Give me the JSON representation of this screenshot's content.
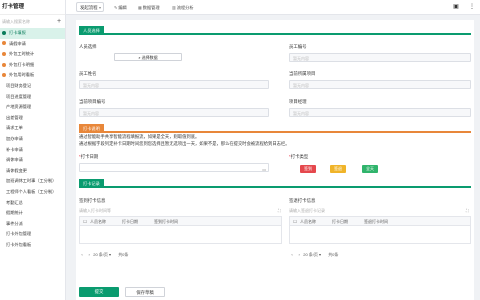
{
  "colors": {
    "primary": "#0a9b6f",
    "orange": "#e8873a",
    "red": "#e5484d",
    "yellow": "#f0b429",
    "green": "#30b46c"
  },
  "sidebar": {
    "title": "打卡管理",
    "search_placeholder": "请输入搜索名称",
    "add_icon": "plus-icon",
    "items": [
      {
        "label": "打卡填报",
        "type": "sub",
        "active": true
      },
      {
        "label": "请假申请",
        "type": "sub"
      },
      {
        "label": "外包工时统计",
        "type": "sub"
      },
      {
        "label": "外包打卡明细",
        "type": "sub"
      },
      {
        "label": "外包用时看板",
        "type": "sub"
      },
      {
        "label": "项目财务登记",
        "type": "plain"
      },
      {
        "label": "项目进度管理",
        "type": "plain"
      },
      {
        "label": "产地资源管理",
        "type": "plain"
      },
      {
        "label": "出差管理",
        "type": "plain"
      },
      {
        "label": "请求工单",
        "type": "plain"
      },
      {
        "label": "加办申请",
        "type": "plain"
      },
      {
        "label": "补卡申请",
        "type": "plain"
      },
      {
        "label": "调休申请",
        "type": "plain"
      },
      {
        "label": "请休假变更",
        "type": "plain"
      },
      {
        "label": "加班调休工时事（工分制）",
        "type": "plain"
      },
      {
        "label": "工程师个人看板（工分制）",
        "type": "plain"
      },
      {
        "label": "考勤汇总",
        "type": "plain"
      },
      {
        "label": "假期统计",
        "type": "plain"
      },
      {
        "label": "事件分派",
        "type": "plain"
      },
      {
        "label": "打卡外包管理",
        "type": "plain"
      },
      {
        "label": "打卡外包看板",
        "type": "plain"
      }
    ]
  },
  "topbar": {
    "dropdown": "发起流程",
    "buttons": [
      "编辑",
      "数据管理",
      "流程分析"
    ],
    "right_icons": [
      "layout-icon",
      "more-icon"
    ]
  },
  "form": {
    "section1": "人员选择",
    "person_label": "人员选择",
    "person_button": "选择数据",
    "employee_no_label": "员工编号",
    "employee_no_placeholder": "暂无内容",
    "employee_name_label": "员工姓名",
    "employee_name_placeholder": "暂无内容",
    "project_manager_label": "当前所属项目",
    "project_manager_placeholder": "暂无内容",
    "project_no_label": "当前项目编号",
    "project_no_placeholder": "暂无内容",
    "project_manager2_label": "项目经理",
    "project_manager2_placeholder": "暂无内容",
    "section2": "打卡说明",
    "notice_line1": "通过智能助手共享智能流程填报流，如果是全天，则取值到底。",
    "notice_line2": "通过根据字段列定补卡日期时间您到您选择且暂无选项出一天，如果不是，那么在提交时会被流程给到日志栏。",
    "date_label": "打卡日期",
    "type_label": "打卡类型",
    "chips": [
      {
        "label": "签到",
        "color": "#e5484d"
      },
      {
        "label": "签退",
        "color": "#f0b429"
      },
      {
        "label": "全天",
        "color": "#30b46c"
      }
    ],
    "section3": "打卡记录",
    "left_table": {
      "title": "签到打卡信息",
      "hint": "请输入打卡时间等",
      "columns": [
        "人员名称",
        "打卡日期",
        "签到打卡时间"
      ],
      "page_size": "20 条/页",
      "total": "共0条"
    },
    "right_table": {
      "title": "签退打卡信息",
      "hint": "请输入签退打卡记录",
      "columns": [
        "人员名称",
        "打卡日期",
        "签退打卡时间"
      ],
      "page_size": "20 条/页",
      "total": "共0条"
    },
    "submit": "提交",
    "save_draft": "保存草稿"
  }
}
